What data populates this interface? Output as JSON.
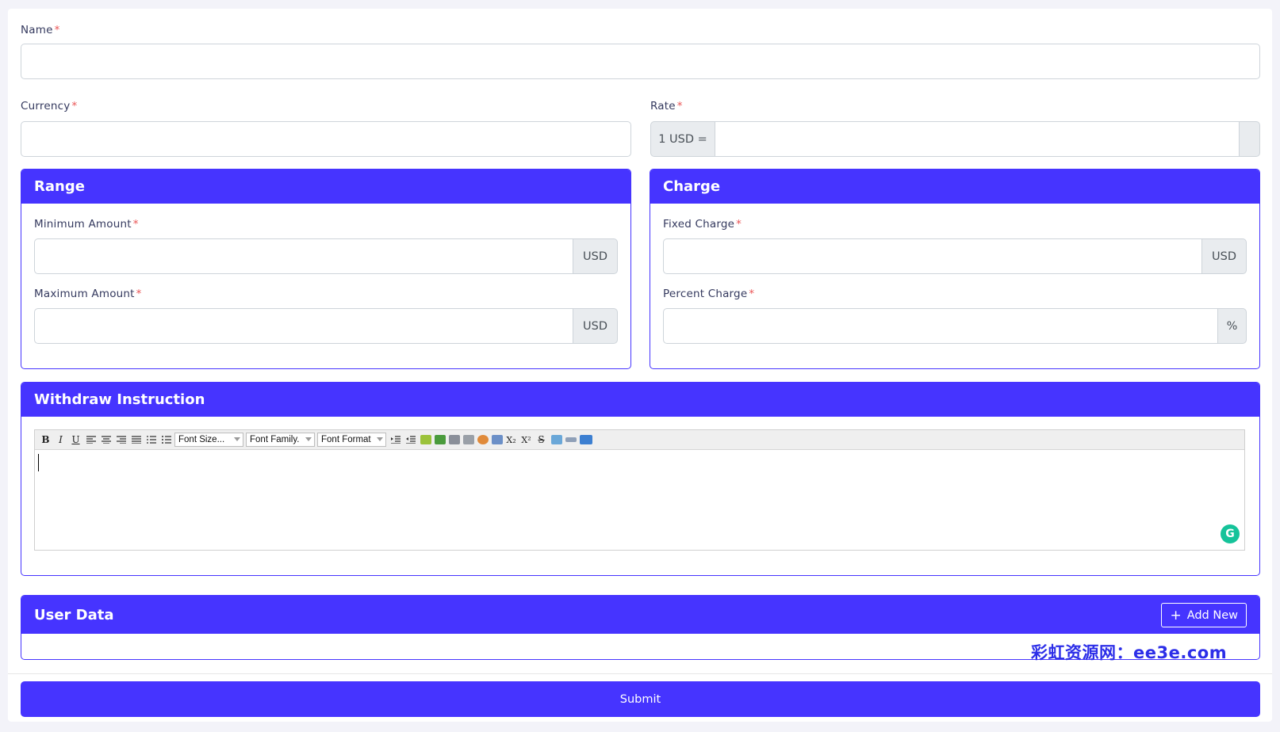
{
  "form": {
    "name_label": "Name",
    "required_mark": "*",
    "name_value": "",
    "currency_label": "Currency",
    "currency_value": "",
    "rate_label": "Rate",
    "rate_prefix": "1 USD =",
    "rate_value": "",
    "rate_suffix": ""
  },
  "range": {
    "title": "Range",
    "min_label": "Minimum Amount",
    "min_value": "",
    "min_unit": "USD",
    "max_label": "Maximum Amount",
    "max_value": "",
    "max_unit": "USD"
  },
  "charge": {
    "title": "Charge",
    "fixed_label": "Fixed Charge",
    "fixed_value": "",
    "fixed_unit": "USD",
    "percent_label": "Percent Charge",
    "percent_value": "",
    "percent_unit": "%"
  },
  "instruction": {
    "title": "Withdraw Instruction",
    "toolbar": {
      "bold": "B",
      "italic": "I",
      "underline": "U",
      "font_size": "Font Size...",
      "font_family": "Font Family.",
      "font_format": "Font Format"
    },
    "content": ""
  },
  "user_data": {
    "title": "User Data",
    "add_new_label": "Add New"
  },
  "submit_label": "Submit",
  "watermark": "彩虹资源网：ee3e.com",
  "colors": {
    "primary": "#4634ff",
    "required": "#ea5455",
    "addon_bg": "#e9ecef",
    "grammarly": "#15c39a"
  }
}
